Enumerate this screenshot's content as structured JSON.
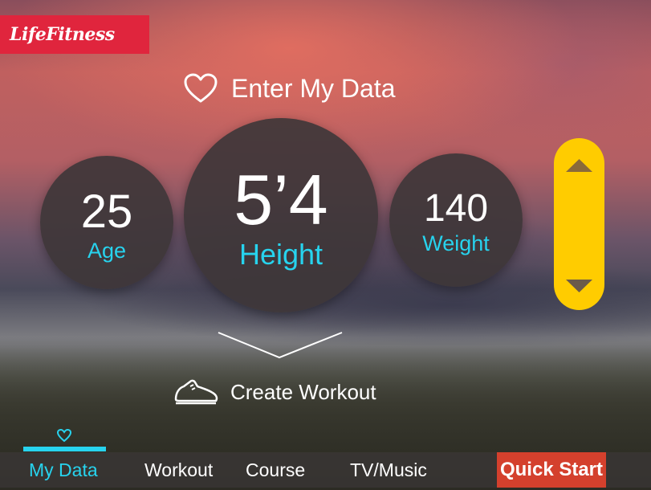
{
  "brand": {
    "logo_text": "LifeFitness",
    "color": "#e0253d"
  },
  "header": {
    "title": "Enter My Data",
    "icon": "heart-icon"
  },
  "metrics": {
    "age": {
      "value": "25",
      "label": "Age"
    },
    "height": {
      "value": "5’4",
      "label": "Height"
    },
    "weight": {
      "value": "140",
      "label": "Weight"
    }
  },
  "scroller": {
    "up_icon": "triangle-up-icon",
    "down_icon": "triangle-down-icon",
    "color": "#ffcc00"
  },
  "create": {
    "label": "Create Workout",
    "icon": "sneaker-icon"
  },
  "nav": {
    "items": [
      {
        "label": "My Data",
        "active": true
      },
      {
        "label": "Workout",
        "active": false
      },
      {
        "label": "Course",
        "active": false
      },
      {
        "label": "TV/Music",
        "active": false
      }
    ],
    "accent": "#27d3ee"
  },
  "quick_start": {
    "label": "Quick Start",
    "color": "#d4402d"
  }
}
